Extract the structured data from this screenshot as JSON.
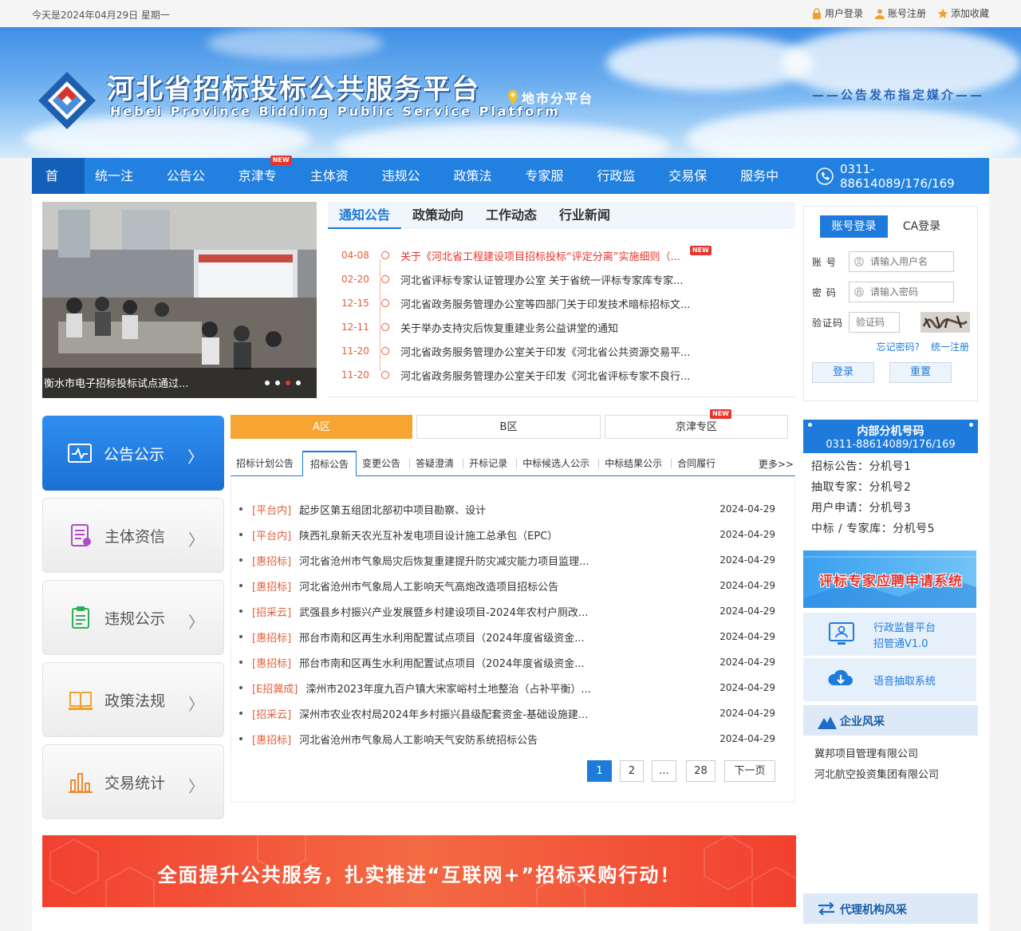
{
  "topbar": {
    "date": "今天是2024年04月29日 星期一",
    "user_login": "用户登录",
    "register": "账号注册",
    "favorite": "添加收藏"
  },
  "banner": {
    "title": "河北省招标投标公共服务平台",
    "subtitle": "Hebei Province Bidding Public Service Platform",
    "city_platform": "地市分平台",
    "slogan": "——公告发布指定媒介——"
  },
  "nav": {
    "items": [
      {
        "label": "首页",
        "active": true
      },
      {
        "label": "统一注册"
      },
      {
        "label": "公告公示"
      },
      {
        "label": "京津专区",
        "badge": "NEW"
      },
      {
        "label": "主体资信"
      },
      {
        "label": "违规公示"
      },
      {
        "label": "政策法规"
      },
      {
        "label": "专家服务"
      },
      {
        "label": "行政监督"
      },
      {
        "label": "交易保障"
      },
      {
        "label": "服务中心"
      }
    ],
    "phone": "0311-88614089/176/169"
  },
  "slideshow": {
    "caption": "衡水市电子招标投标试点通过..."
  },
  "news": {
    "tabs": [
      "通知公告",
      "政策动向",
      "工作动态",
      "行业新闻"
    ],
    "badge": "NEW",
    "items": [
      {
        "date": "04-08",
        "title": "关于《河北省工程建设项目招标投标“评定分离”实施细则（...",
        "hot": true
      },
      {
        "date": "02-20",
        "title": "河北省评标专家认证管理办公室 关于省统一评标专家库专家..."
      },
      {
        "date": "12-15",
        "title": "河北省政务服务管理办公室等四部门关于印发技术暗标招标文..."
      },
      {
        "date": "12-11",
        "title": "关于举办支持灾后恢复重建业务公益讲堂的通知"
      },
      {
        "date": "11-20",
        "title": "河北省政务服务管理办公室关于印发《河北省公共资源交易平..."
      },
      {
        "date": "11-20",
        "title": "河北省政务服务管理办公室关于印发《河北省评标专家不良行..."
      }
    ]
  },
  "login": {
    "tab_account": "账号登录",
    "tab_ca": "CA登录",
    "account_label": "账 号",
    "account_placeholder": "请输入用户名",
    "password_label": "密 码",
    "password_placeholder": "请输入密码",
    "captcha_label": "验证码",
    "captcha_placeholder": "验证码",
    "forgot": "忘记密码?",
    "register": "统一注册",
    "login_btn": "登录",
    "reset_btn": "重置"
  },
  "side_menu": [
    {
      "label": "公告公示",
      "icon": "pulse-chart-icon",
      "active": true
    },
    {
      "label": "主体资信",
      "icon": "document-icon"
    },
    {
      "label": "违规公示",
      "icon": "clipboard-icon"
    },
    {
      "label": "政策法规",
      "icon": "book-icon"
    },
    {
      "label": "交易统计",
      "icon": "bar-chart-icon"
    }
  ],
  "zones": {
    "items": [
      "A区",
      "B区",
      "京津专区"
    ],
    "badge": "NEW"
  },
  "subtabs": {
    "items": [
      "招标计划公告",
      "招标公告",
      "变更公告",
      "答疑澄清",
      "开标记录",
      "中标候选人公示",
      "中标结果公示",
      "合同履行"
    ],
    "active_index": 1,
    "more": "更多>>"
  },
  "announcements": [
    {
      "tag": "[平台内]",
      "title": "起步区第五组团北部初中项目勘察、设计",
      "date": "2024-04-29"
    },
    {
      "tag": "[平台内]",
      "title": "陕西礼泉新天农光互补发电项目设计施工总承包（EPC）",
      "date": "2024-04-29"
    },
    {
      "tag": "[惠招标]",
      "title": "河北省沧州市气象局灾后恢复重建提升防灾减灾能力项目监理...",
      "date": "2024-04-29"
    },
    {
      "tag": "[惠招标]",
      "title": "河北省沧州市气象局人工影响天气高炮改造项目招标公告",
      "date": "2024-04-29"
    },
    {
      "tag": "[招采云]",
      "title": "武强县乡村振兴产业发展暨乡村建设项目-2024年农村户厕改...",
      "date": "2024-04-29"
    },
    {
      "tag": "[惠招标]",
      "title": "邢台市南和区再生水利用配置试点项目（2024年度省级资金...",
      "date": "2024-04-29"
    },
    {
      "tag": "[惠招标]",
      "title": "邢台市南和区再生水利用配置试点项目（2024年度省级资金...",
      "date": "2024-04-29"
    },
    {
      "tag": "[E招冀成]",
      "title": "滦州市2023年度九百户镇大宋家峪村土地整治（占补平衡）...",
      "date": "2024-04-29"
    },
    {
      "tag": "[招采云]",
      "title": "深州市农业农村局2024年乡村振兴县级配套资金-基础设施建...",
      "date": "2024-04-29"
    },
    {
      "tag": "[惠招标]",
      "title": "河北省沧州市气象局人工影响天气安防系统招标公告",
      "date": "2024-04-29"
    }
  ],
  "pagination": {
    "pages": [
      "1",
      "2",
      "...",
      "28"
    ],
    "current": "1",
    "next": "下一页"
  },
  "extension": {
    "title": "内部分机号码",
    "phone": "0311-88614089/176/169",
    "items": [
      "招标公告：分机号1",
      "抽取专家：分机号2",
      "用户申请：分机号3",
      "中标 / 专家库：分机号5"
    ]
  },
  "expert_banner": "评标专家应聘申请系统",
  "systems": {
    "supervision_line1": "行政监督平台",
    "supervision_line2": "招管通V1.0",
    "voice": "语音抽取系统"
  },
  "enterprise": {
    "heading": "企业风采",
    "firms": [
      "冀邦项目管理有限公司",
      "河北航空投资集团有限公司"
    ]
  },
  "agency_heading": "代理机构风采",
  "promo_text": "全面提升公共服务，扎实推进“互联网+”招标采购行动！",
  "colors": {
    "primary": "#2280e0",
    "nav_active": "#1260b8",
    "accent_orange": "#f6a533",
    "alert_red": "#e8342c",
    "date_orange": "#e0603a"
  }
}
